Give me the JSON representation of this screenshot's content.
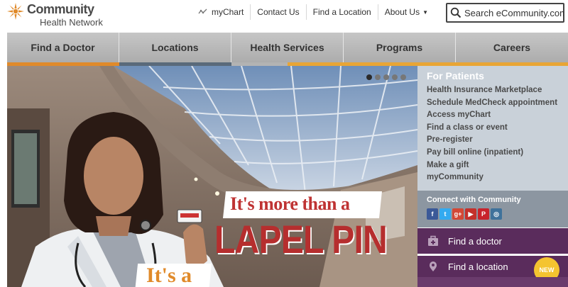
{
  "brand": {
    "name_line1": "Community",
    "name_line2": "Health Network",
    "logo_icon": "sunburst-logo-icon",
    "accent_orange": "#e08a2a"
  },
  "utility_nav": {
    "mychart": "myChart",
    "contact": "Contact Us",
    "find_location": "Find a Location",
    "about": "About Us"
  },
  "search": {
    "placeholder": "Search eCommunity.com"
  },
  "main_nav": {
    "items": [
      "Find a Doctor",
      "Locations",
      "Health Services",
      "Programs",
      "Careers"
    ],
    "accent_colors": [
      "#e08a2a",
      "#5a6a7a",
      "#b3b3b3",
      "#e8a535",
      "#e8a535"
    ]
  },
  "hero": {
    "slide_count": 5,
    "active_slide": 1,
    "headline_1": "It's more than a",
    "headline_2": "LAPEL PIN",
    "headline_3": "It's a"
  },
  "for_patients": {
    "title": "For Patients",
    "links": [
      "Health Insurance Marketplace",
      "Schedule MedCheck appointment",
      "Access myChart",
      "Find a class or event",
      "Pre-register",
      "Pay bill online (inpatient)",
      "Make a gift",
      "myCommunity"
    ]
  },
  "connect": {
    "title": "Connect with Community",
    "icons": [
      "facebook-icon",
      "twitter-icon",
      "google-plus-icon",
      "youtube-icon",
      "pinterest-icon",
      "instagram-icon"
    ]
  },
  "cta": {
    "find_doctor": "Find a doctor",
    "find_location": "Find a location",
    "new_badge": "NEW"
  }
}
